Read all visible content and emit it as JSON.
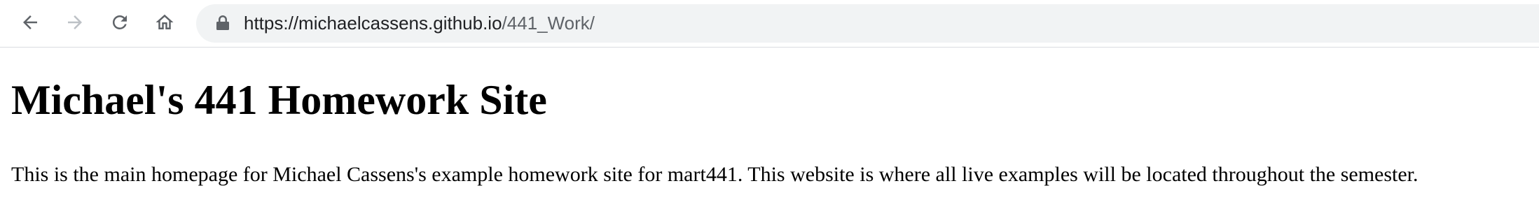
{
  "browser": {
    "url_host": "https://michaelcassens.github.io",
    "url_path": "/441_Work/",
    "icons": {
      "back": "arrow-left-icon",
      "forward": "arrow-right-icon",
      "reload": "reload-icon",
      "home": "home-icon",
      "lock": "lock-icon"
    },
    "colors": {
      "omnibox_bg": "#f1f3f4",
      "icon_active": "#5f6368",
      "icon_disabled": "#bdc1c6"
    }
  },
  "page": {
    "heading": "Michael's 441 Homework Site",
    "body": "This is the main homepage for Michael Cassens's example homework site for mart441. This website is where all live examples will be located throughout the semester."
  }
}
